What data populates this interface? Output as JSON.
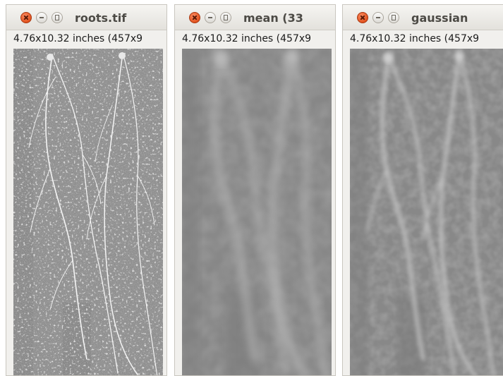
{
  "windows": [
    {
      "id": "w1",
      "title": "roots.tif",
      "subtitle": "4.76x10.32 inches (457x9",
      "image": "roots-original"
    },
    {
      "id": "w2",
      "title": "mean (33",
      "subtitle": "4.76x10.32 inches (457x9",
      "image": "roots-mean-filtered"
    },
    {
      "id": "w3",
      "title": "gaussian",
      "subtitle": "4.76x10.32 inches (457x9",
      "image": "roots-gaussian-filtered"
    }
  ],
  "icons": {
    "close": "close-icon",
    "minimize": "minimize-icon",
    "maximize": "maximize-icon"
  },
  "colors": {
    "close_button": "#e2521e",
    "window_bg": "#f1f0ed",
    "image_bg": "#8d8d8d"
  }
}
